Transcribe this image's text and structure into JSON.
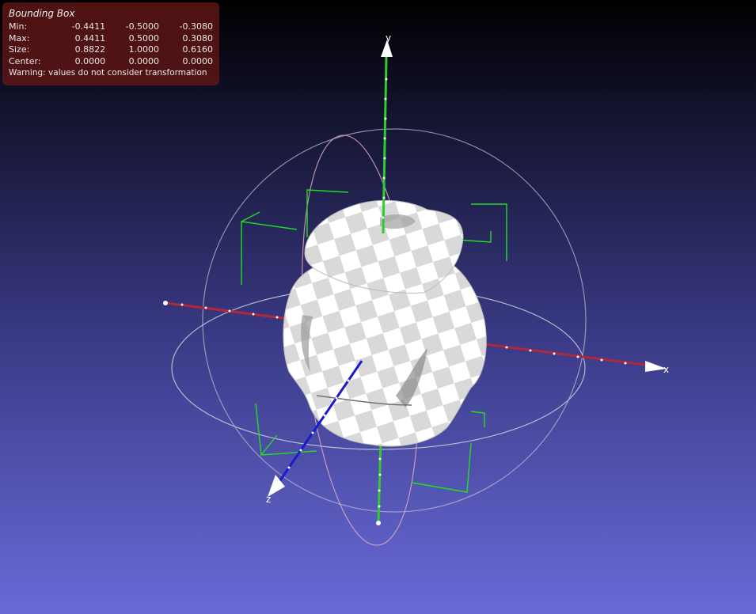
{
  "bounding_box": {
    "title": "Bounding Box",
    "rows": [
      {
        "label": "Min:",
        "x": "-0.4411",
        "y": "-0.5000",
        "z": "-0.3080"
      },
      {
        "label": "Max:",
        "x": "0.4411",
        "y": "0.5000",
        "z": "0.3080"
      },
      {
        "label": "Size:",
        "x": "0.8822",
        "y": "1.0000",
        "z": "0.6160"
      },
      {
        "label": "Center:",
        "x": "0.0000",
        "y": "0.0000",
        "z": "0.0000"
      }
    ],
    "warning": "Warning: values do not consider transformation"
  },
  "axes": {
    "x_label": "x",
    "y_label": "y",
    "z_label": "z"
  },
  "colors": {
    "x_axis": "#b0283a",
    "y_axis": "#2ecc2e",
    "z_axis": "#1a1acc",
    "bbox_lines": "#22dd22",
    "trackball": "#c8c8d8"
  }
}
